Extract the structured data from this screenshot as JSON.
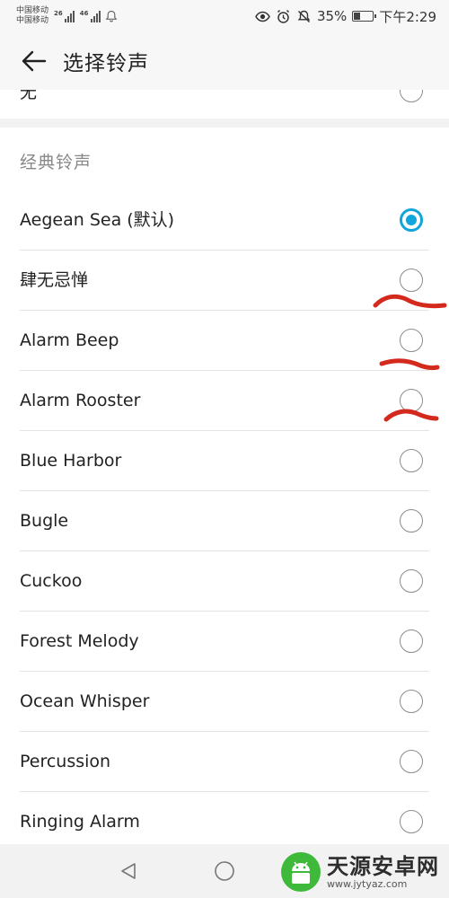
{
  "status_bar": {
    "carrier_1": "中国移动",
    "carrier_2": "中国移动",
    "network_1": "26",
    "network_2": "46",
    "battery": "35%",
    "battery_level": 0.35,
    "time": "下午2:29"
  },
  "app_bar": {
    "title": "选择铃声"
  },
  "partial_item": {
    "label": "无"
  },
  "section": {
    "header": "经典铃声",
    "items": [
      {
        "label": "Aegean Sea (默认)",
        "selected": true
      },
      {
        "label": "肆无忌惮",
        "selected": false
      },
      {
        "label": "Alarm Beep",
        "selected": false
      },
      {
        "label": "Alarm Rooster",
        "selected": false
      },
      {
        "label": "Blue Harbor",
        "selected": false
      },
      {
        "label": "Bugle",
        "selected": false
      },
      {
        "label": "Cuckoo",
        "selected": false
      },
      {
        "label": "Forest Melody",
        "selected": false
      },
      {
        "label": "Ocean Whisper",
        "selected": false
      },
      {
        "label": "Percussion",
        "selected": false
      },
      {
        "label": "Ringing Alarm",
        "selected": false
      }
    ]
  },
  "colors": {
    "accent": "#12a5da",
    "annotation": "#d42a1e"
  },
  "watermark": {
    "title": "天源安卓网",
    "url": "www.jytyaz.com"
  }
}
